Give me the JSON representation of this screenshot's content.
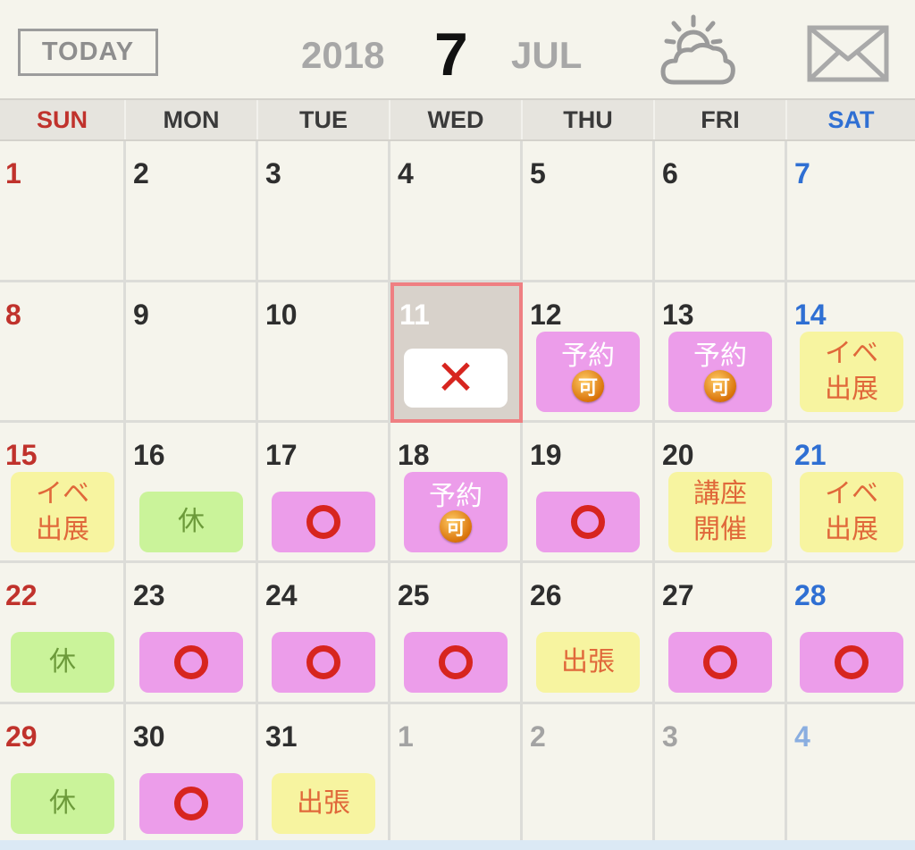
{
  "header": {
    "today_label": "TODAY",
    "year": "2018",
    "month_number": "7",
    "month_name": "JUL",
    "weather_icon": "partly-cloudy-icon",
    "mail_icon": "envelope-icon"
  },
  "colors": {
    "sunday": "#c0322c",
    "saturday": "#2f6fd3",
    "pink_badge": "#ec9dea",
    "yellow_badge": "#f7f4a0",
    "green_badge": "#caf39a",
    "red_mark": "#d7251f",
    "selected_border": "#ef7f82"
  },
  "weekdays": [
    "SUN",
    "MON",
    "TUE",
    "WED",
    "THU",
    "FRI",
    "SAT"
  ],
  "weeks": [
    [
      {
        "day": "1"
      },
      {
        "day": "2"
      },
      {
        "day": "3"
      },
      {
        "day": "4"
      },
      {
        "day": "5"
      },
      {
        "day": "6"
      },
      {
        "day": "7"
      }
    ],
    [
      {
        "day": "8"
      },
      {
        "day": "9"
      },
      {
        "day": "10"
      },
      {
        "day": "11",
        "selected": true,
        "badge": {
          "type": "cross",
          "color": "white"
        }
      },
      {
        "day": "12",
        "badge": {
          "type": "text",
          "color": "pink",
          "text": "予約",
          "sub": "可"
        }
      },
      {
        "day": "13",
        "badge": {
          "type": "text",
          "color": "pink",
          "text": "予約",
          "sub": "可"
        }
      },
      {
        "day": "14",
        "badge": {
          "type": "text",
          "color": "yellow",
          "text": "イベ\n出展"
        }
      }
    ],
    [
      {
        "day": "15",
        "badge": {
          "type": "text",
          "color": "yellow",
          "text": "イベ\n出展"
        }
      },
      {
        "day": "16",
        "badge": {
          "type": "text",
          "color": "green",
          "text": "休"
        }
      },
      {
        "day": "17",
        "badge": {
          "type": "circle",
          "color": "pink"
        }
      },
      {
        "day": "18",
        "badge": {
          "type": "text",
          "color": "pink",
          "text": "予約",
          "sub": "可"
        }
      },
      {
        "day": "19",
        "badge": {
          "type": "circle",
          "color": "pink"
        }
      },
      {
        "day": "20",
        "badge": {
          "type": "text",
          "color": "yellow",
          "text": "講座\n開催"
        }
      },
      {
        "day": "21",
        "badge": {
          "type": "text",
          "color": "yellow",
          "text": "イベ\n出展"
        }
      }
    ],
    [
      {
        "day": "22",
        "badge": {
          "type": "text",
          "color": "green",
          "text": "休"
        }
      },
      {
        "day": "23",
        "badge": {
          "type": "circle",
          "color": "pink"
        }
      },
      {
        "day": "24",
        "badge": {
          "type": "circle",
          "color": "pink"
        }
      },
      {
        "day": "25",
        "badge": {
          "type": "circle",
          "color": "pink"
        }
      },
      {
        "day": "26",
        "badge": {
          "type": "text",
          "color": "yellow",
          "text": "出張"
        }
      },
      {
        "day": "27",
        "badge": {
          "type": "circle",
          "color": "pink"
        }
      },
      {
        "day": "28",
        "badge": {
          "type": "circle",
          "color": "pink"
        }
      }
    ],
    [
      {
        "day": "29",
        "badge": {
          "type": "text",
          "color": "green",
          "text": "休"
        }
      },
      {
        "day": "30",
        "badge": {
          "type": "circle",
          "color": "pink"
        }
      },
      {
        "day": "31",
        "badge": {
          "type": "text",
          "color": "yellow",
          "text": "出張"
        }
      },
      {
        "day": "1",
        "outside": true
      },
      {
        "day": "2",
        "outside": true
      },
      {
        "day": "3",
        "outside": true
      },
      {
        "day": "4",
        "outside": true
      }
    ]
  ]
}
